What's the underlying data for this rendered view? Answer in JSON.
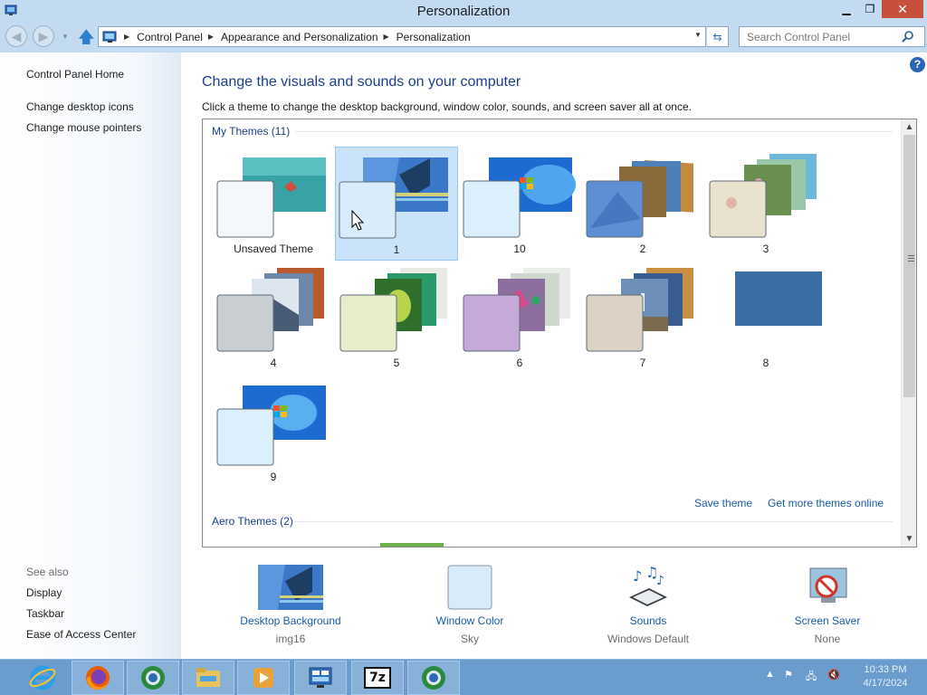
{
  "window": {
    "title": "Personalization",
    "controls": {
      "minimize": "▁",
      "restore": "❐",
      "close": "✕"
    }
  },
  "nav": {
    "back_icon": "back-arrow-icon",
    "forward_icon": "forward-arrow-icon",
    "up_icon": "up-arrow-icon",
    "breadcrumb": [
      "Control Panel",
      "Appearance and Personalization",
      "Personalization"
    ],
    "search_placeholder": "Search Control Panel"
  },
  "sidebar": {
    "home": "Control Panel Home",
    "tasks": [
      "Change desktop icons",
      "Change mouse pointers"
    ],
    "see_also_label": "See also",
    "see_also": [
      "Display",
      "Taskbar",
      "Ease of Access Center"
    ]
  },
  "main": {
    "heading": "Change the visuals and sounds on your computer",
    "description": "Click a theme to change the desktop background, window color, sounds, and screen saver all at once.",
    "my_themes_header": "My Themes (11)",
    "aero_themes_header": "Aero Themes (2)",
    "themes": [
      {
        "label": "Unsaved Theme",
        "selected": false
      },
      {
        "label": "1",
        "selected": true
      },
      {
        "label": "10",
        "selected": false
      },
      {
        "label": "2",
        "selected": false
      },
      {
        "label": "3",
        "selected": false
      },
      {
        "label": "4",
        "selected": false
      },
      {
        "label": "5",
        "selected": false
      },
      {
        "label": "6",
        "selected": false
      },
      {
        "label": "7",
        "selected": false
      },
      {
        "label": "8",
        "selected": false
      },
      {
        "label": "9",
        "selected": false
      }
    ],
    "save_theme": "Save theme",
    "get_more": "Get more themes online"
  },
  "bottom": {
    "desktop_background": {
      "title": "Desktop Background",
      "value": "img16"
    },
    "window_color": {
      "title": "Window Color",
      "value": "Sky"
    },
    "sounds": {
      "title": "Sounds",
      "value": "Windows Default"
    },
    "screen_saver": {
      "title": "Screen Saver",
      "value": "None"
    }
  },
  "taskbar": {
    "apps": [
      "internet-explorer-icon",
      "firefox-icon",
      "browser-icon",
      "file-explorer-icon",
      "media-player-icon",
      "control-panel-icon",
      "7zip-icon",
      "browser-icon"
    ],
    "zip_label": "7z",
    "clock_time": "10:33 PM",
    "clock_date": "4/17/2024"
  },
  "colors": {
    "accent": "#1a3e8c",
    "link": "#1a5aa5",
    "selection": "#cbe3f9",
    "taskbar": "#6a9ccd",
    "titlebar": "#c3dbf1"
  }
}
